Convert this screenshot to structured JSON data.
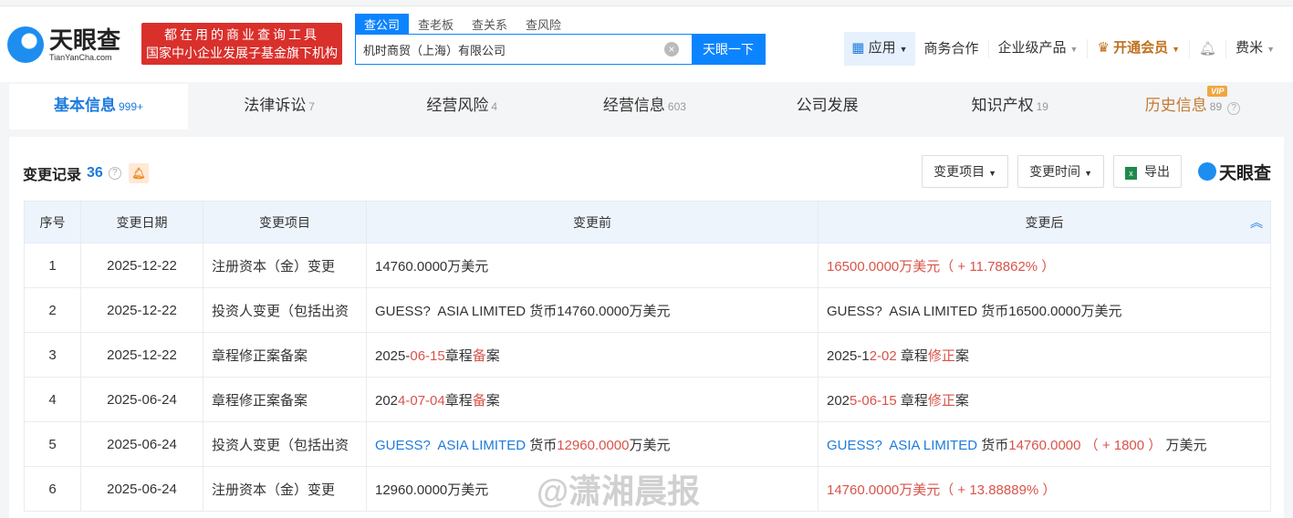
{
  "header": {
    "logo_cn": "天眼查",
    "logo_en": "TianYanCha.com",
    "slogan_line1": "都在用的商业查询工具",
    "slogan_line2": "国家中小企业发展子基金旗下机构",
    "search_tabs": [
      "查公司",
      "查老板",
      "查关系",
      "查风险"
    ],
    "search_value": "机时商贸（上海）有限公司",
    "search_button": "天眼一下",
    "nav": {
      "app": "应用",
      "business": "商务合作",
      "enterprise": "企业级产品",
      "vip": "开通会员",
      "user": "费米"
    }
  },
  "tabs": [
    {
      "label": "基本信息",
      "count": "999+"
    },
    {
      "label": "法律诉讼",
      "count": "7"
    },
    {
      "label": "经营风险",
      "count": "4"
    },
    {
      "label": "经营信息",
      "count": "603"
    },
    {
      "label": "公司发展",
      "count": ""
    },
    {
      "label": "知识产权",
      "count": "19"
    },
    {
      "label": "历史信息",
      "count": "89",
      "badge": "VIP"
    }
  ],
  "section": {
    "title": "变更记录",
    "count": "36",
    "filter_item": "变更项目",
    "filter_time": "变更时间",
    "export": "导出",
    "brand": "天眼查"
  },
  "table": {
    "headers": [
      "序号",
      "变更日期",
      "变更项目",
      "变更前",
      "变更后"
    ],
    "rows": [
      {
        "no": "1",
        "date": "2025-12-22",
        "item": "注册资本（金）变更",
        "before": [
          {
            "t": "14760.0000万美元"
          }
        ],
        "after": [
          {
            "t": "16500.0000万美元（ + 11.78862% ）",
            "c": "r"
          }
        ]
      },
      {
        "no": "2",
        "date": "2025-12-22",
        "item": "投资人变更（包括出资",
        "before": [
          {
            "t": "GUESS?  ASIA LIMITED 货币14760.0000万美元"
          }
        ],
        "after": [
          {
            "t": "GUESS?  ASIA LIMITED 货币16500.0000万美元"
          }
        ]
      },
      {
        "no": "3",
        "date": "2025-12-22",
        "item": "章程修正案备案",
        "before": [
          {
            "t": "2025-"
          },
          {
            "t": "06-15",
            "c": "r"
          },
          {
            "t": "章程"
          },
          {
            "t": "备",
            "c": "r"
          },
          {
            "t": "案"
          }
        ],
        "after": [
          {
            "t": "2025-1"
          },
          {
            "t": "2-02",
            "c": "r"
          },
          {
            "t": " 章程"
          },
          {
            "t": "修正",
            "c": "r"
          },
          {
            "t": "案"
          }
        ]
      },
      {
        "no": "4",
        "date": "2025-06-24",
        "item": "章程修正案备案",
        "before": [
          {
            "t": "202"
          },
          {
            "t": "4-07-04",
            "c": "r"
          },
          {
            "t": "章程"
          },
          {
            "t": "备",
            "c": "r"
          },
          {
            "t": "案"
          }
        ],
        "after": [
          {
            "t": "202"
          },
          {
            "t": "5-06-15",
            "c": "r"
          },
          {
            "t": " 章程"
          },
          {
            "t": "修正",
            "c": "r"
          },
          {
            "t": "案"
          }
        ]
      },
      {
        "no": "5",
        "date": "2025-06-24",
        "item": "投资人变更（包括出资",
        "before": [
          {
            "t": "GUESS?  ASIA LIMITED",
            "c": "b"
          },
          {
            "t": " 货币"
          },
          {
            "t": "12960.0000",
            "c": "r"
          },
          {
            "t": "万美元"
          }
        ],
        "after": [
          {
            "t": "GUESS?  ASIA LIMITED",
            "c": "b"
          },
          {
            "t": " 货币"
          },
          {
            "t": "14760.0000 （ + 1800 ）",
            "c": "r"
          },
          {
            "t": " 万美元"
          }
        ]
      },
      {
        "no": "6",
        "date": "2025-06-24",
        "item": "注册资本（金）变更",
        "before": [
          {
            "t": "12960.0000万美元"
          }
        ],
        "after": [
          {
            "t": "14760.0000万美元（ + 13.88889% ）",
            "c": "r"
          }
        ]
      }
    ]
  },
  "watermark": "@潇湘晨报"
}
